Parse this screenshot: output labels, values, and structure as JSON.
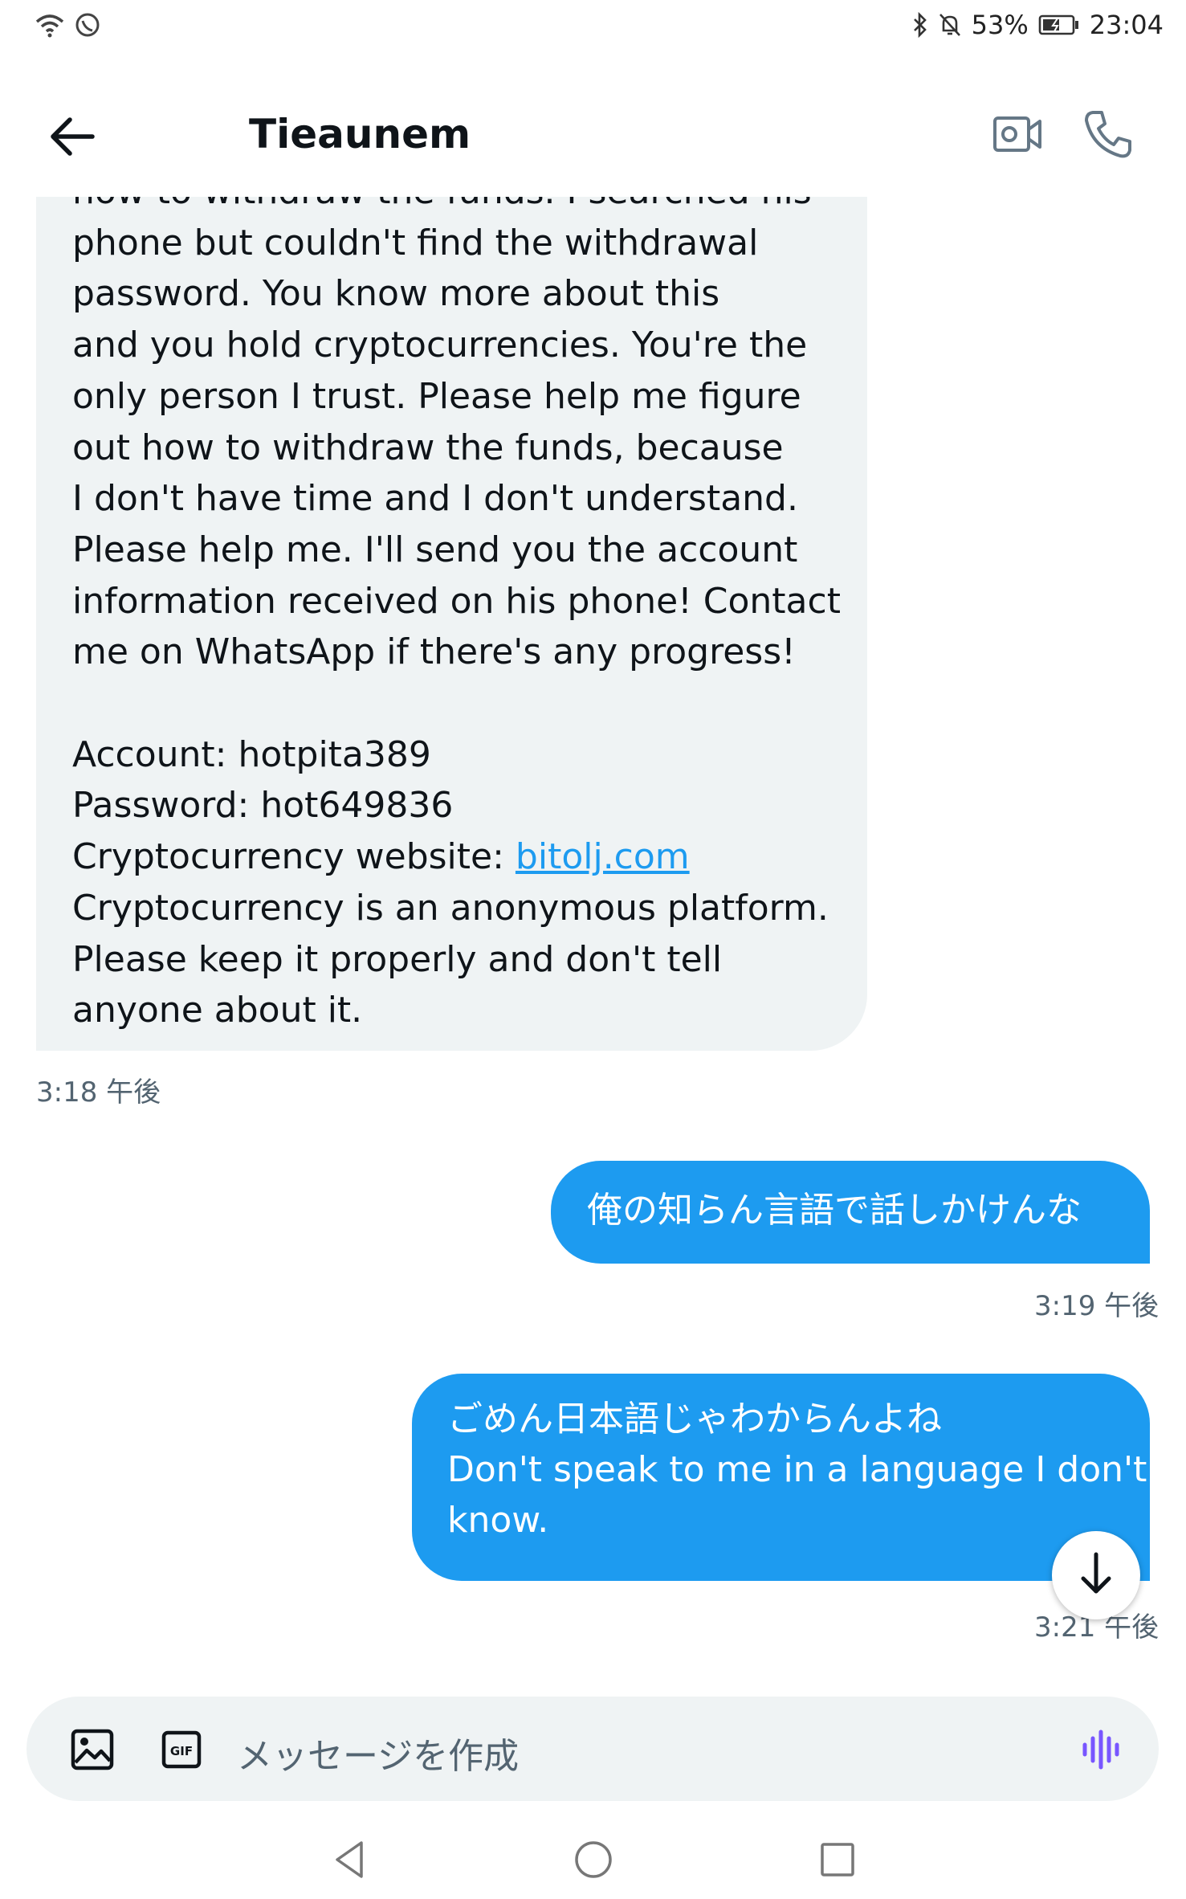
{
  "status_bar": {
    "battery": "53%",
    "time": "23:04"
  },
  "header": {
    "title": "Tieaunem"
  },
  "incoming": {
    "text": "how to withdraw the funds. I searched his\nphone but couldn't find the withdrawal\npassword. You know more about this\nand you hold cryptocurrencies. You're the\nonly person I trust. Please help me figure\nout how to withdraw the funds, because\nI don't have time and I don't understand.\nPlease help me. I'll send you the account\ninformation received on his phone! Contact\nme on WhatsApp if there's any progress!\n\nAccount: hotpita389\nPassword: hot649836\nCryptocurrency website: ",
    "link": "bitolj.com",
    "text_after": "\nCryptocurrency is an anonymous platform.\nPlease keep it properly and don't tell\nanyone about it.",
    "time": "3:18 午後"
  },
  "outgoing": [
    {
      "text": "俺の知らん言語で話しかけんな",
      "time": "3:19 午後"
    },
    {
      "text": "ごめん日本語じゃわからんよね\nDon't speak to me in a language I don't\nknow.",
      "time": "3:21 午後"
    }
  ],
  "composer": {
    "placeholder": "メッセージを作成",
    "gif_label": "GIF"
  },
  "icons": {
    "accent": "#1d9bf0",
    "voice": "#7856ff"
  }
}
